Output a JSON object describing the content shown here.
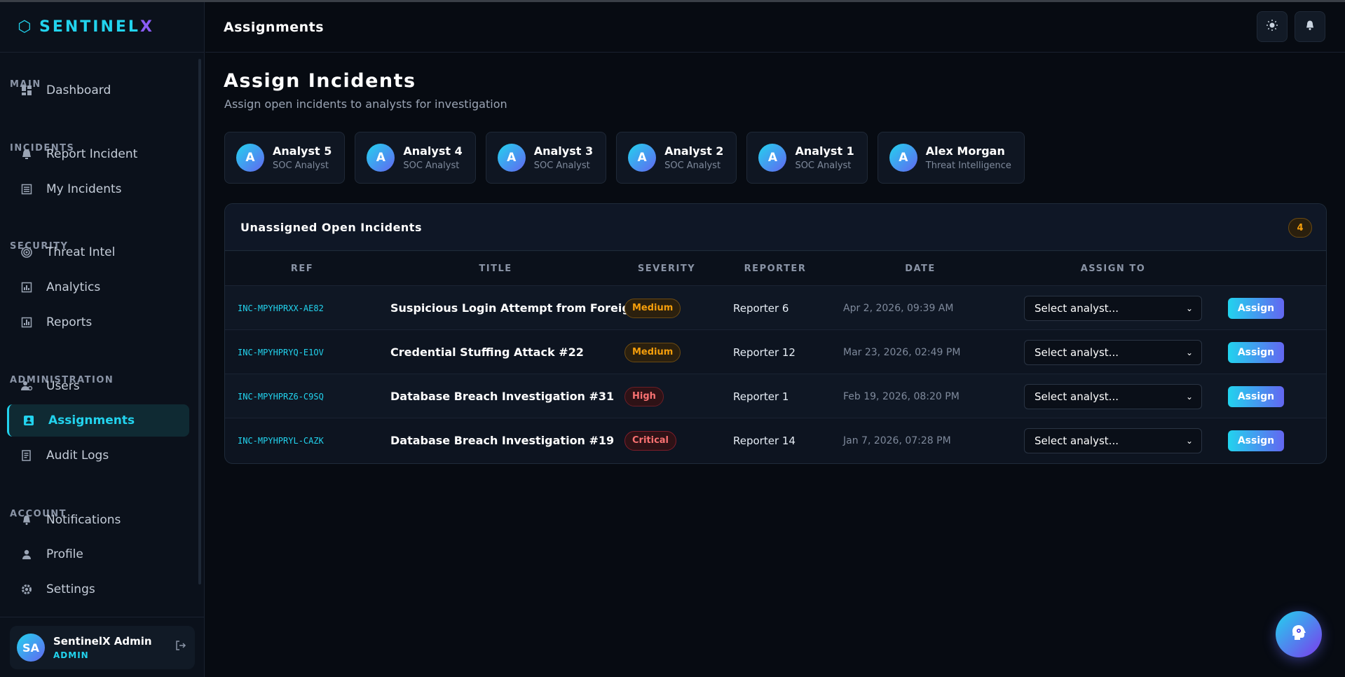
{
  "brand": {
    "name_main": "SENTINEL",
    "name_accent": "X",
    "icon": "hexagon-icon"
  },
  "header": {
    "title": "Assignments",
    "theme_icon": "sun-icon",
    "notify_icon": "bell-icon"
  },
  "sidebar": {
    "sections": [
      {
        "title": "MAIN",
        "items": [
          {
            "label": "Dashboard",
            "icon": "dashboard-icon"
          }
        ]
      },
      {
        "title": "INCIDENTS",
        "items": [
          {
            "label": "Report Incident",
            "icon": "alarm-icon"
          },
          {
            "label": "My Incidents",
            "icon": "list-icon"
          }
        ]
      },
      {
        "title": "SECURITY",
        "items": [
          {
            "label": "Threat Intel",
            "icon": "target-icon"
          },
          {
            "label": "Analytics",
            "icon": "analytics-icon"
          },
          {
            "label": "Reports",
            "icon": "reports-icon"
          }
        ]
      },
      {
        "title": "ADMINISTRATION",
        "items": [
          {
            "label": "Users",
            "icon": "users-icon"
          },
          {
            "label": "Assignments",
            "icon": "assignment-icon",
            "active": true
          },
          {
            "label": "Audit Logs",
            "icon": "audit-icon"
          }
        ]
      },
      {
        "title": "ACCOUNT",
        "items": [
          {
            "label": "Notifications",
            "icon": "bell-icon"
          },
          {
            "label": "Profile",
            "icon": "person-icon"
          },
          {
            "label": "Settings",
            "icon": "gear-icon"
          }
        ]
      }
    ],
    "user": {
      "initials": "SA",
      "name": "SentinelX Admin",
      "role": "ADMIN"
    }
  },
  "main": {
    "title": "Assign Incidents",
    "subtitle": "Assign open incidents to analysts for investigation",
    "analysts": [
      {
        "initial": "A",
        "name": "Analyst 5",
        "role": "SOC Analyst"
      },
      {
        "initial": "A",
        "name": "Analyst 4",
        "role": "SOC Analyst"
      },
      {
        "initial": "A",
        "name": "Analyst 3",
        "role": "SOC Analyst"
      },
      {
        "initial": "A",
        "name": "Analyst 2",
        "role": "SOC Analyst"
      },
      {
        "initial": "A",
        "name": "Analyst 1",
        "role": "SOC Analyst"
      },
      {
        "initial": "A",
        "name": "Alex Morgan",
        "role": "Threat Intelligence"
      }
    ],
    "panel": {
      "title": "Unassigned Open Incidents",
      "count": "4",
      "columns": [
        "REF",
        "TITLE",
        "SEVERITY",
        "REPORTER",
        "DATE",
        "ASSIGN TO"
      ],
      "rows": [
        {
          "ref": "INC-MPYHPRXX-AE82",
          "title": "Suspicious Login Attempt from Foreig...",
          "severity": "Medium",
          "reporter": "Reporter 6",
          "date": "Apr 2, 2026, 09:39 AM",
          "select": "Select analyst...",
          "action": "Assign"
        },
        {
          "ref": "INC-MPYHPRYQ-E1OV",
          "title": "Credential Stuffing Attack #22",
          "severity": "Medium",
          "reporter": "Reporter 12",
          "date": "Mar 23, 2026, 02:49 PM",
          "select": "Select analyst...",
          "action": "Assign"
        },
        {
          "ref": "INC-MPYHPRZ6-C9SQ",
          "title": "Database Breach Investigation #31",
          "severity": "High",
          "reporter": "Reporter 1",
          "date": "Feb 19, 2026, 08:20 PM",
          "select": "Select analyst...",
          "action": "Assign"
        },
        {
          "ref": "INC-MPYHPRYL-CAZK",
          "title": "Database Breach Investigation #19",
          "severity": "Critical",
          "reporter": "Reporter 14",
          "date": "Jan 7, 2026, 07:28 PM",
          "select": "Select analyst...",
          "action": "Assign"
        }
      ]
    }
  },
  "fab": {
    "icon": "ai-assistant-icon"
  },
  "colors": {
    "accent": "#22d3ee",
    "accent2": "#6366f1",
    "bg": "#070b12"
  }
}
